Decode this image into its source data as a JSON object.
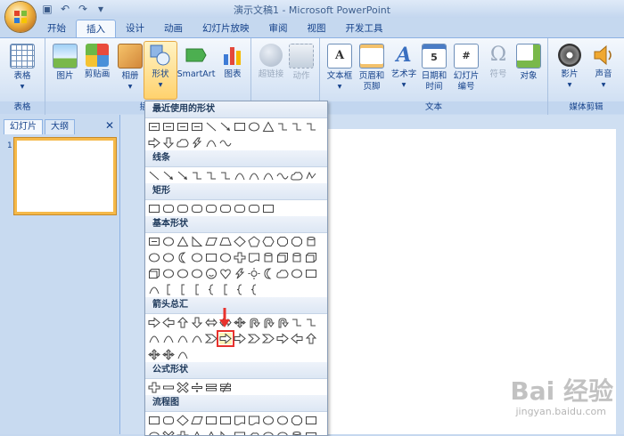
{
  "window": {
    "title": "演示文稿1 - Microsoft PowerPoint"
  },
  "tabs": [
    "开始",
    "插入",
    "设计",
    "动画",
    "幻灯片放映",
    "审阅",
    "视图",
    "开发工具"
  ],
  "active_tab": "插入",
  "ribbon": {
    "groups": [
      {
        "label": "表格",
        "buttons": [
          {
            "label1": "表格",
            "label2": "▾"
          }
        ]
      },
      {
        "label": "插图",
        "buttons": [
          {
            "label1": "图片",
            "label2": ""
          },
          {
            "label1": "剪贴画",
            "label2": ""
          },
          {
            "label1": "相册",
            "label2": "▾"
          },
          {
            "label1": "形状",
            "label2": "▾"
          },
          {
            "label1": "SmartArt",
            "label2": ""
          },
          {
            "label1": "图表",
            "label2": ""
          }
        ]
      },
      {
        "label": "",
        "buttons": [
          {
            "label1": "超链接",
            "label2": ""
          },
          {
            "label1": "动作",
            "label2": ""
          }
        ]
      },
      {
        "label": "文本",
        "buttons": [
          {
            "label1": "文本框",
            "label2": "▾"
          },
          {
            "label1": "页眉和",
            "label2": "页脚"
          },
          {
            "label1": "艺术字",
            "label2": "▾"
          },
          {
            "label1": "日期和",
            "label2": "时间"
          },
          {
            "label1": "幻灯片",
            "label2": "编号"
          },
          {
            "label1": "符号",
            "label2": ""
          },
          {
            "label1": "对象",
            "label2": ""
          }
        ]
      },
      {
        "label": "媒体剪辑",
        "buttons": [
          {
            "label1": "影片",
            "label2": "▾"
          },
          {
            "label1": "声音",
            "label2": "▾"
          }
        ]
      }
    ]
  },
  "side_panel": {
    "tabs": [
      "幻灯片",
      "大纲"
    ],
    "close": "✕",
    "slide_number": "1"
  },
  "gallery": {
    "sections": [
      "最近使用的形状",
      "线条",
      "矩形",
      "基本形状",
      "箭头总汇",
      "公式形状",
      "流程图"
    ]
  },
  "watermark": {
    "text": "Bai 经验",
    "sub": "jingyan.baidu.com"
  }
}
